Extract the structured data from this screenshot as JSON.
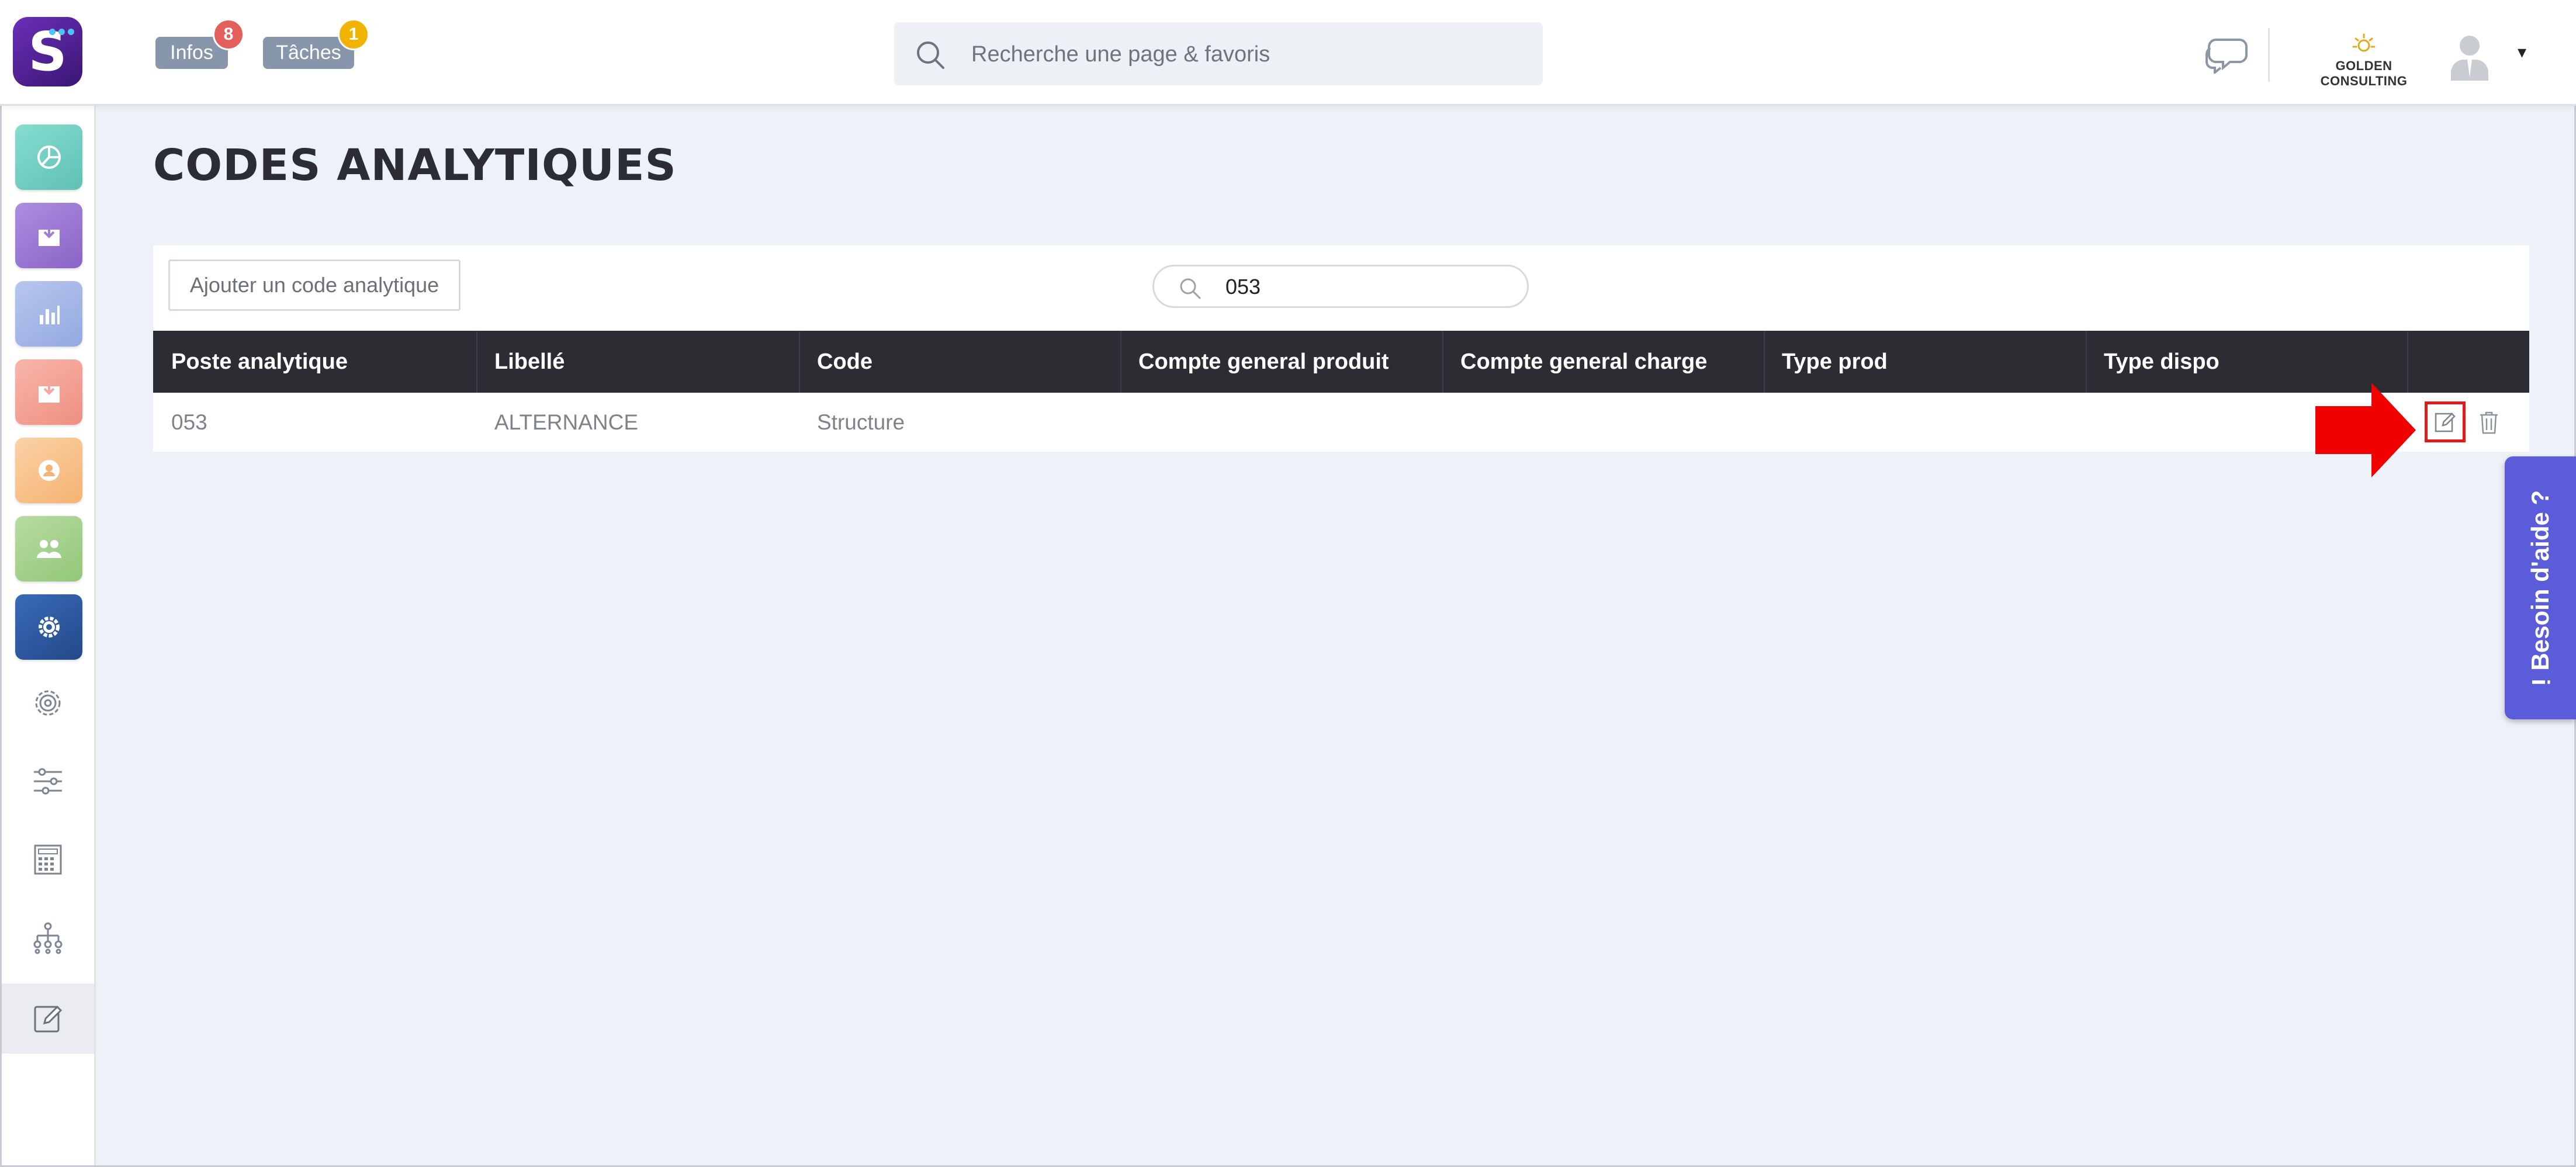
{
  "header": {
    "search_placeholder": "Recherche une page & favoris",
    "infos_label": "Infos",
    "infos_count": "8",
    "taches_label": "Tâches",
    "taches_count": "1",
    "company_name": "GOLDEN CONSULTING",
    "user_menu_caret": "▾"
  },
  "sidebar": {
    "items": [
      {
        "icon": "pie-chart-icon",
        "color": "#7fd1c6"
      },
      {
        "icon": "download-box-icon",
        "color": "#a07dd4"
      },
      {
        "icon": "bar-chart-icon",
        "color": "#aabbe8"
      },
      {
        "icon": "download-box-icon",
        "color": "#f4a79a"
      },
      {
        "icon": "user-icon",
        "color": "#f8c48e"
      },
      {
        "icon": "users-icon",
        "color": "#a8d38f"
      },
      {
        "icon": "settings-icon",
        "color": "#2f5aa0"
      },
      {
        "icon": "gear-outline-icon"
      },
      {
        "icon": "sliders-icon"
      },
      {
        "icon": "calculator-icon"
      },
      {
        "icon": "org-chart-icon"
      },
      {
        "icon": "edit-icon",
        "active": true
      }
    ]
  },
  "page": {
    "title": "CODES ANALYTIQUES",
    "add_button": "Ajouter un code analytique",
    "filter_value": "053"
  },
  "table": {
    "columns": [
      "Poste analytique",
      "Libellé",
      "Code",
      "Compte general produit",
      "Compte general charge",
      "Type prod",
      "Type dispo"
    ],
    "rows": [
      {
        "poste": "053",
        "libelle": "ALTERNANCE",
        "code": "Structure",
        "compte_produit": "",
        "compte_charge": "",
        "type_prod": "",
        "type_dispo": ""
      }
    ]
  },
  "help": {
    "label": "Besoin d'aide ?",
    "icon": "info-icon"
  },
  "colors": {
    "brand": "#5b2a9e",
    "table_header": "#2b2d33",
    "highlight": "#e21a1a",
    "help_tab": "#5b5cd9",
    "badge_red": "#e25f5b",
    "badge_yellow": "#f0b400"
  }
}
